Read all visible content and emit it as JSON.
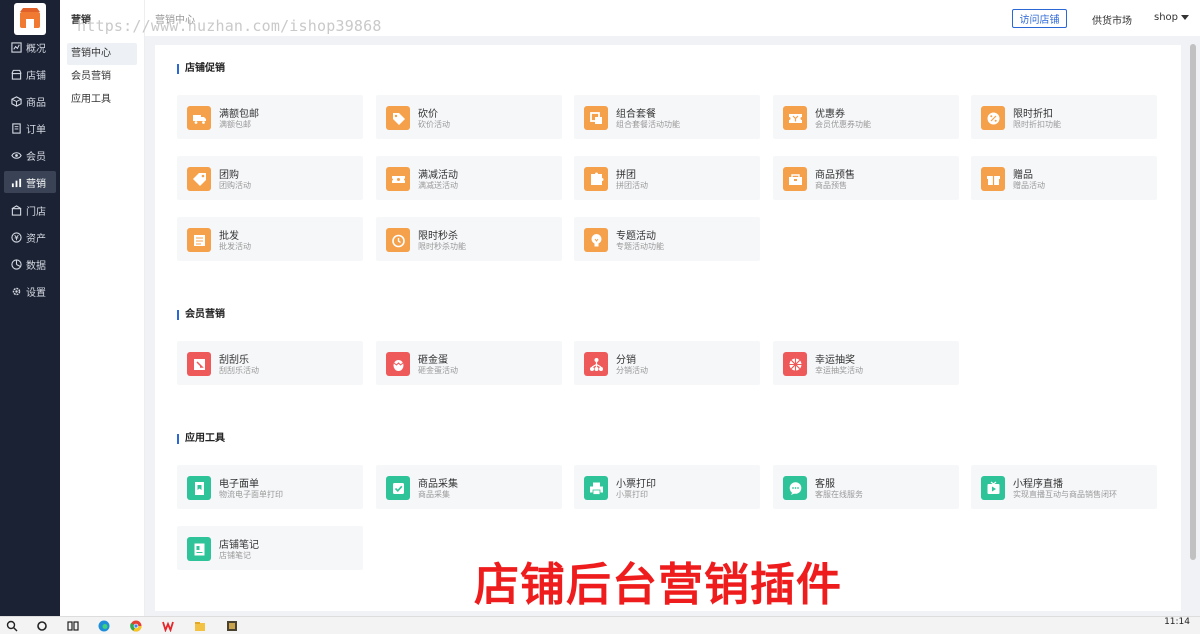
{
  "watermark": "https://www.huzhan.com/ishop39868",
  "rail": {
    "items": [
      {
        "label": "概况",
        "icon": "chart-icon"
      },
      {
        "label": "店铺",
        "icon": "store-icon"
      },
      {
        "label": "商品",
        "icon": "box-icon"
      },
      {
        "label": "订单",
        "icon": "order-icon"
      },
      {
        "label": "会员",
        "icon": "member-icon"
      },
      {
        "label": "营销",
        "icon": "marketing-icon"
      },
      {
        "label": "门店",
        "icon": "shop-icon"
      },
      {
        "label": "资产",
        "icon": "asset-icon"
      },
      {
        "label": "数据",
        "icon": "data-icon"
      },
      {
        "label": "设置",
        "icon": "gear-icon"
      }
    ]
  },
  "subnav": {
    "title": "营销",
    "items": [
      "营销中心",
      "会员营销",
      "应用工具"
    ]
  },
  "header": {
    "breadcrumb": "营销中心",
    "visit_label": "访问店铺",
    "market_label": "供货市场",
    "shop_label": "shop"
  },
  "sections": [
    {
      "title": "店铺促销",
      "cards": [
        {
          "name": "满额包邮",
          "desc": "满额包邮",
          "icon": "truck-icon",
          "color": "#f5a04a"
        },
        {
          "name": "砍价",
          "desc": "砍价活动",
          "icon": "tag-cut-icon",
          "color": "#f5a04a"
        },
        {
          "name": "组合套餐",
          "desc": "组合套餐活动功能",
          "icon": "combo-icon",
          "color": "#f5a04a"
        },
        {
          "name": "优惠券",
          "desc": "会员优惠券功能",
          "icon": "coupon-icon",
          "color": "#f5a04a"
        },
        {
          "name": "限时折扣",
          "desc": "限时折扣功能",
          "icon": "discount-icon",
          "color": "#f5a04a"
        },
        {
          "name": "团购",
          "desc": "团购活动",
          "icon": "group-tag-icon",
          "color": "#f5a04a"
        },
        {
          "name": "满减活动",
          "desc": "满减送活动",
          "icon": "ticket-icon",
          "color": "#f5a04a"
        },
        {
          "name": "拼团",
          "desc": "拼团活动",
          "icon": "puzzle-icon",
          "color": "#f5a04a"
        },
        {
          "name": "商品预售",
          "desc": "商品预售",
          "icon": "presale-icon",
          "color": "#f5a04a"
        },
        {
          "name": "赠品",
          "desc": "赠品活动",
          "icon": "gift-icon",
          "color": "#f5a04a"
        },
        {
          "name": "批发",
          "desc": "批发活动",
          "icon": "wholesale-icon",
          "color": "#f5a04a"
        },
        {
          "name": "限时秒杀",
          "desc": "限时秒杀功能",
          "icon": "alarm-icon",
          "color": "#f5a04a"
        },
        {
          "name": "专题活动",
          "desc": "专题活动功能",
          "icon": "bulb-icon",
          "color": "#f5a04a"
        }
      ]
    },
    {
      "title": "会员营销",
      "cards": [
        {
          "name": "刮刮乐",
          "desc": "刮刮乐活动",
          "icon": "scratch-icon",
          "color": "#ee5a5a"
        },
        {
          "name": "砸金蛋",
          "desc": "砸金蛋活动",
          "icon": "egg-icon",
          "color": "#ee5a5a"
        },
        {
          "name": "分销",
          "desc": "分销活动",
          "icon": "distribution-icon",
          "color": "#ee5a5a"
        },
        {
          "name": "幸运抽奖",
          "desc": "幸运抽奖活动",
          "icon": "lottery-icon",
          "color": "#ee5a5a"
        }
      ]
    },
    {
      "title": "应用工具",
      "cards": [
        {
          "name": "电子面单",
          "desc": "物流电子面单打印",
          "icon": "waybill-icon",
          "color": "#2fc39a"
        },
        {
          "name": "商品采集",
          "desc": "商品采集",
          "icon": "collect-icon",
          "color": "#2fc39a"
        },
        {
          "name": "小票打印",
          "desc": "小票打印",
          "icon": "printer-icon",
          "color": "#2fc39a"
        },
        {
          "name": "客服",
          "desc": "客服在线服务",
          "icon": "chat-icon",
          "color": "#2fc39a"
        },
        {
          "name": "小程序直播",
          "desc": "实现直播互动与商品销售闭环",
          "icon": "live-icon",
          "color": "#2fc39a"
        },
        {
          "name": "店铺笔记",
          "desc": "店铺笔记",
          "icon": "note-icon",
          "color": "#2fc39a"
        }
      ]
    }
  ],
  "banner": "店铺后台营销插件",
  "taskbar": {
    "time": "11:14"
  }
}
